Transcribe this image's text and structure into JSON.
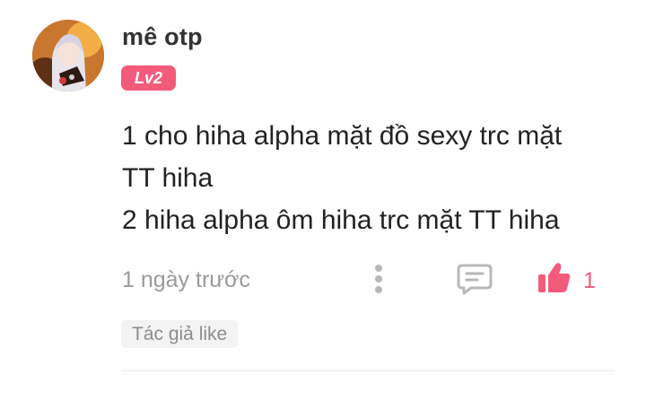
{
  "comment": {
    "username": "mê otp",
    "level_badge": "Lv2",
    "lines": [
      "1 cho hiha alpha mặt đồ sexy trc mặt",
      "TT hiha",
      "2 hiha alpha ôm hiha trc mặt TT hiha"
    ],
    "timestamp": "1 ngày trước",
    "like_count": "1",
    "author_liked_tag": "Tác giả like"
  },
  "icons": {
    "more": "more-vertical-icon",
    "reply": "comment-icon",
    "like": "thumbs-up-icon"
  },
  "colors": {
    "accent": "#f25c7a",
    "muted_text": "#9a9a9a",
    "icon_gray": "#b8b8b8",
    "tag_bg": "#f3f3f3"
  }
}
